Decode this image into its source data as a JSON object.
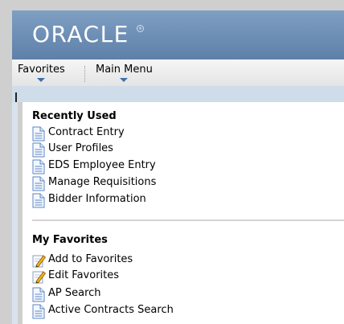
{
  "header": {
    "logo_text": "ORACLE",
    "logo_mark": "®"
  },
  "nav": {
    "favorites_label": "Favorites",
    "main_menu_label": "Main Menu"
  },
  "recently_used": {
    "title": "Recently Used",
    "items": [
      {
        "label": "Contract Entry",
        "icon": "document-icon"
      },
      {
        "label": "User Profiles",
        "icon": "document-icon"
      },
      {
        "label": "EDS Employee Entry",
        "icon": "document-icon"
      },
      {
        "label": "Manage Requisitions",
        "icon": "document-icon"
      },
      {
        "label": "Bidder Information",
        "icon": "document-icon"
      }
    ]
  },
  "my_favorites": {
    "title": "My Favorites",
    "items": [
      {
        "label": "Add to Favorites",
        "icon": "pencil-icon"
      },
      {
        "label": "Edit Favorites",
        "icon": "pencil-icon"
      },
      {
        "label": "AP Search",
        "icon": "document-icon"
      },
      {
        "label": "Active Contracts Search",
        "icon": "document-icon"
      }
    ]
  },
  "colors": {
    "header_blue": "#6b8cb3",
    "nav_arrow": "#3f6fa8",
    "band_blue": "#cfddeb"
  }
}
